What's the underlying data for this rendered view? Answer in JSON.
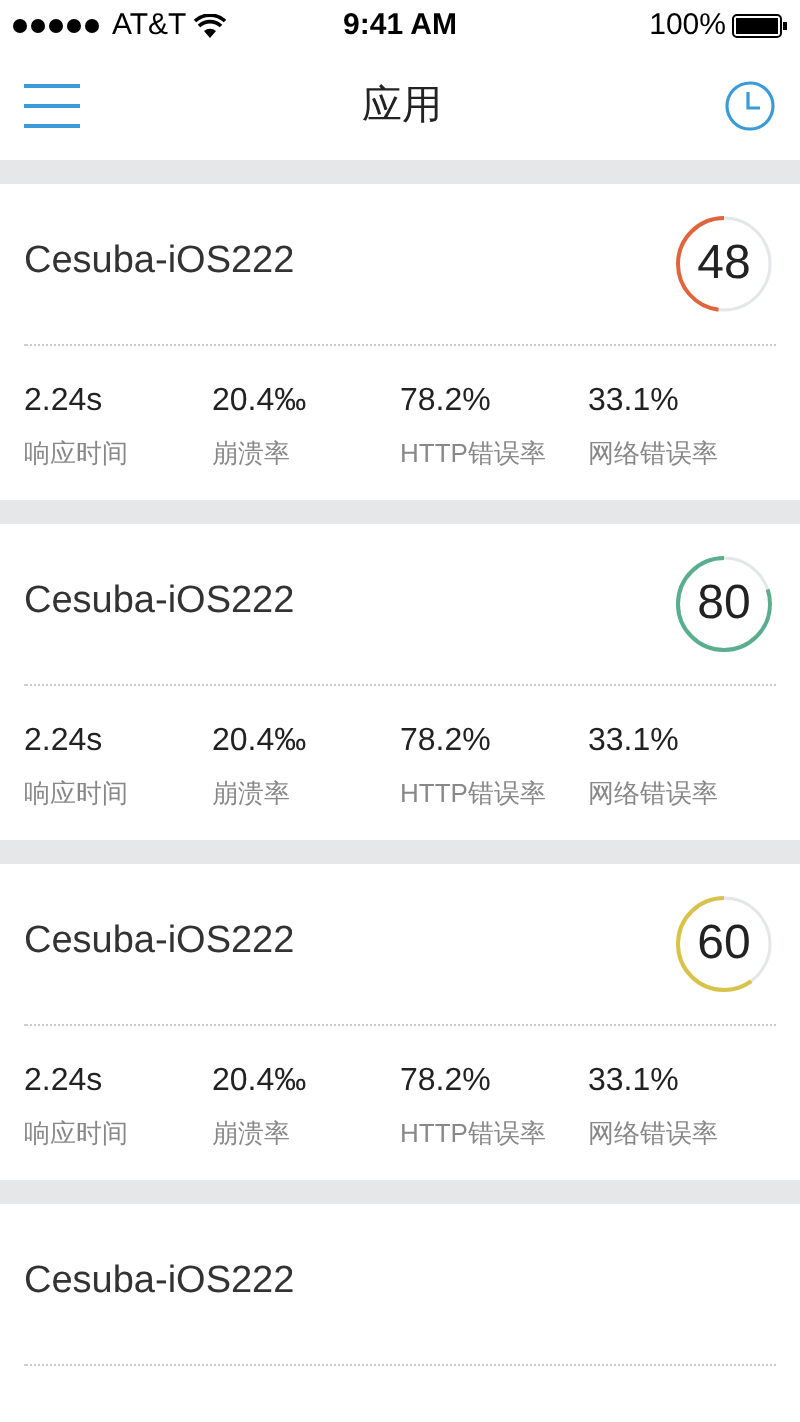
{
  "status_bar": {
    "carrier": "AT&T",
    "time": "9:41 AM",
    "battery": "100%"
  },
  "nav": {
    "title": "应用"
  },
  "apps": [
    {
      "name": "Cesuba-iOS222",
      "score": "48",
      "color": "#e0643c",
      "metrics": [
        {
          "value": "2.24s",
          "label": "响应时间"
        },
        {
          "value": "20.4‰",
          "label": "崩溃率"
        },
        {
          "value": "78.2%",
          "label": "HTTP错误率"
        },
        {
          "value": "33.1%",
          "label": "网络错误率"
        }
      ]
    },
    {
      "name": "Cesuba-iOS222",
      "score": "80",
      "color": "#5aae8e",
      "metrics": [
        {
          "value": "2.24s",
          "label": "响应时间"
        },
        {
          "value": "20.4‰",
          "label": "崩溃率"
        },
        {
          "value": "78.2%",
          "label": "HTTP错误率"
        },
        {
          "value": "33.1%",
          "label": "网络错误率"
        }
      ]
    },
    {
      "name": "Cesuba-iOS222",
      "score": "60",
      "color": "#d9c24a",
      "metrics": [
        {
          "value": "2.24s",
          "label": "响应时间"
        },
        {
          "value": "20.4‰",
          "label": "崩溃率"
        },
        {
          "value": "78.2%",
          "label": "HTTP错误率"
        },
        {
          "value": "33.1%",
          "label": "网络错误率"
        }
      ]
    },
    {
      "name": "Cesuba-iOS222"
    }
  ]
}
